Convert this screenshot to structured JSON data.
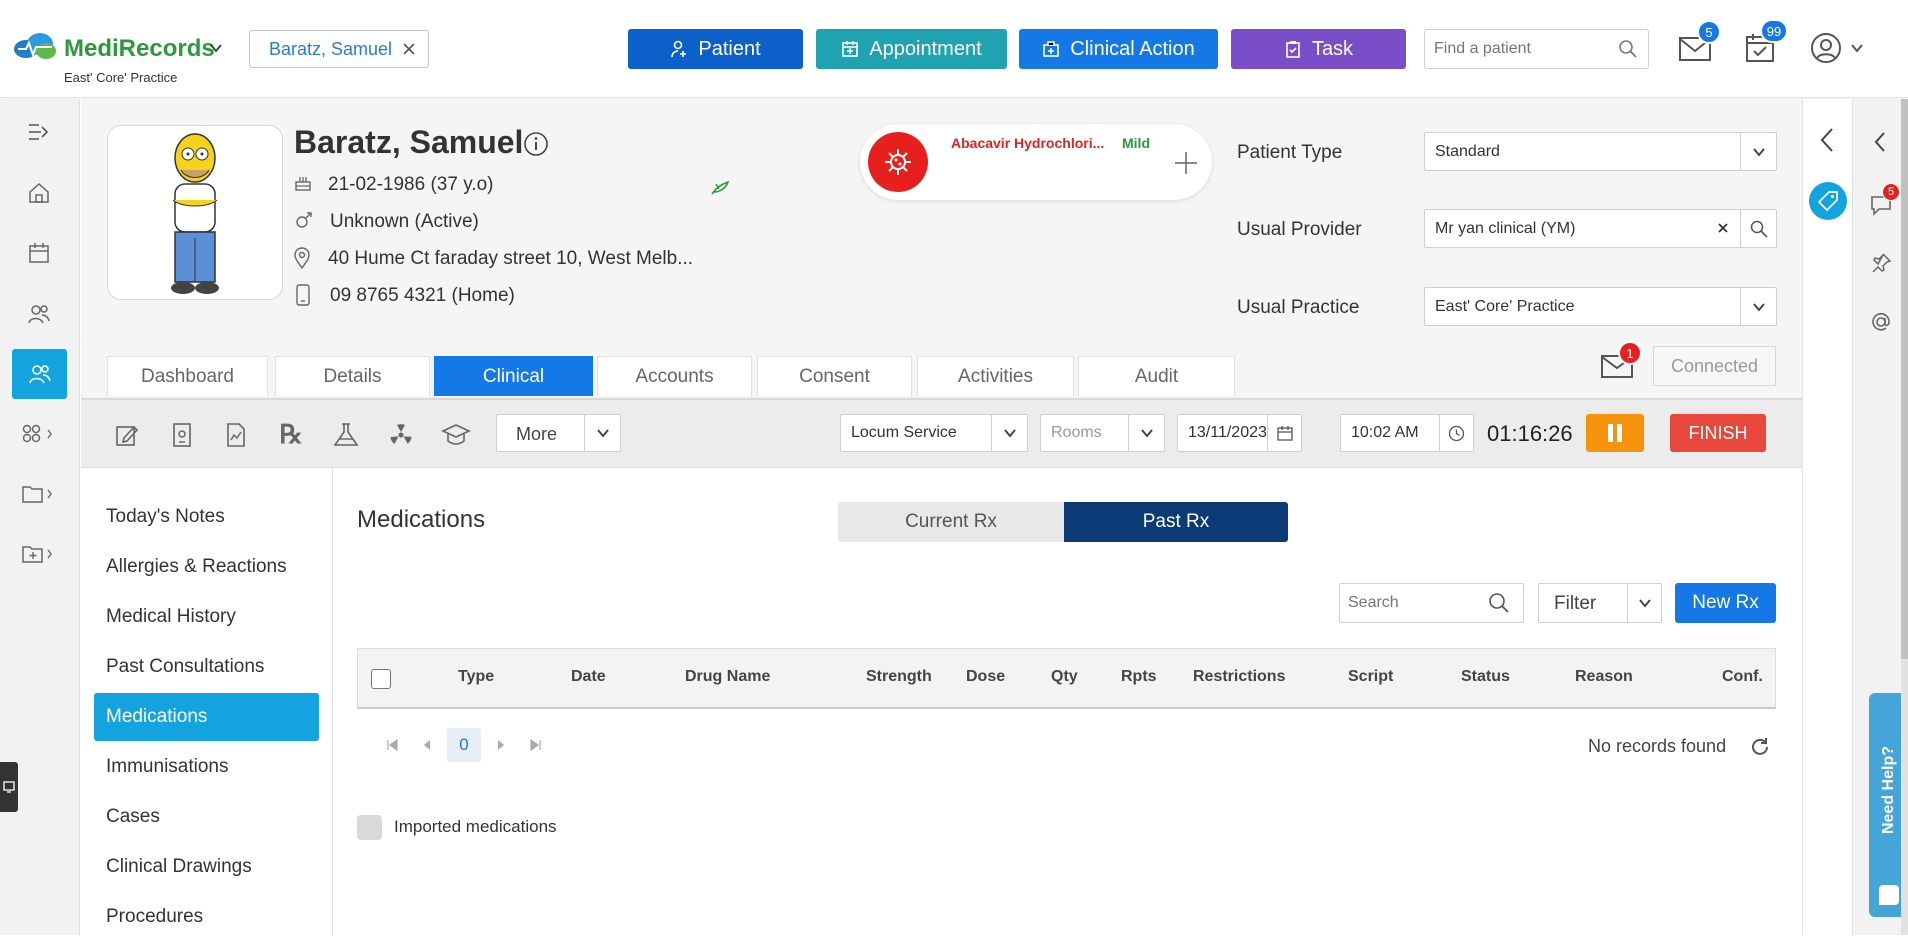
{
  "brand": {
    "name": "MediRecords",
    "practice": "East' Core' Practice"
  },
  "patient_chip": {
    "name": "Baratz, Samuel"
  },
  "top_actions": {
    "patient": "Patient",
    "appointment": "Appointment",
    "clinical_action": "Clinical Action",
    "task": "Task"
  },
  "search": {
    "placeholder": "Find a patient"
  },
  "counts": {
    "messages": "5",
    "tasks": "99"
  },
  "colors": {
    "patient": "#0b61c9",
    "appointment": "#1fa3b1",
    "clinical_action": "#1478e6",
    "task": "#7a4ec8",
    "active_nav": "#13a4e0",
    "pause": "#f5930c",
    "finish": "#e8473c",
    "past_rx": "#0b3a77"
  },
  "patient": {
    "name": "Baratz, Samuel",
    "dob": "21-02-1986 (37 y.o)",
    "gender": "Unknown (Active)",
    "address": "40 Hume Ct faraday street 10, West Melb...",
    "phone": "09 8765 4321 (Home)"
  },
  "allergy": {
    "name": "Abacavir Hydrochlori...",
    "severity": "Mild"
  },
  "fields": {
    "patient_type_label": "Patient Type",
    "patient_type_value": "Standard",
    "usual_provider_label": "Usual Provider",
    "usual_provider_value": "Mr yan clinical (YM)",
    "usual_practice_label": "Usual Practice",
    "usual_practice_value": "East' Core' Practice"
  },
  "tabs": [
    "Dashboard",
    "Details",
    "Clinical",
    "Accounts",
    "Consent",
    "Activities",
    "Audit"
  ],
  "connection": {
    "unread": "1",
    "status": "Connected"
  },
  "toolbar": {
    "more": "More",
    "service": "Locum Service",
    "rooms_placeholder": "Rooms",
    "date": "13/11/2023",
    "time": "10:02 AM",
    "timer": "01:16:26",
    "finish": "FINISH"
  },
  "nav_items": [
    "Today's Notes",
    "Allergies & Reactions",
    "Medical History",
    "Past Consultations",
    "Medications",
    "Immunisations",
    "Cases",
    "Clinical Drawings",
    "Procedures"
  ],
  "medications": {
    "title": "Medications",
    "toggle_current": "Current Rx",
    "toggle_past": "Past Rx",
    "search_placeholder": "Search",
    "filter": "Filter",
    "new_rx": "New Rx",
    "columns": [
      "Type",
      "Date",
      "Drug Name",
      "Strength",
      "Dose",
      "Qty",
      "Rpts",
      "Restrictions",
      "Script",
      "Status",
      "Reason",
      "Conf."
    ],
    "page": "0",
    "no_records": "No records found",
    "imported_label": "Imported medications"
  },
  "help": {
    "label": "Need Help?"
  },
  "right_badge": "5"
}
